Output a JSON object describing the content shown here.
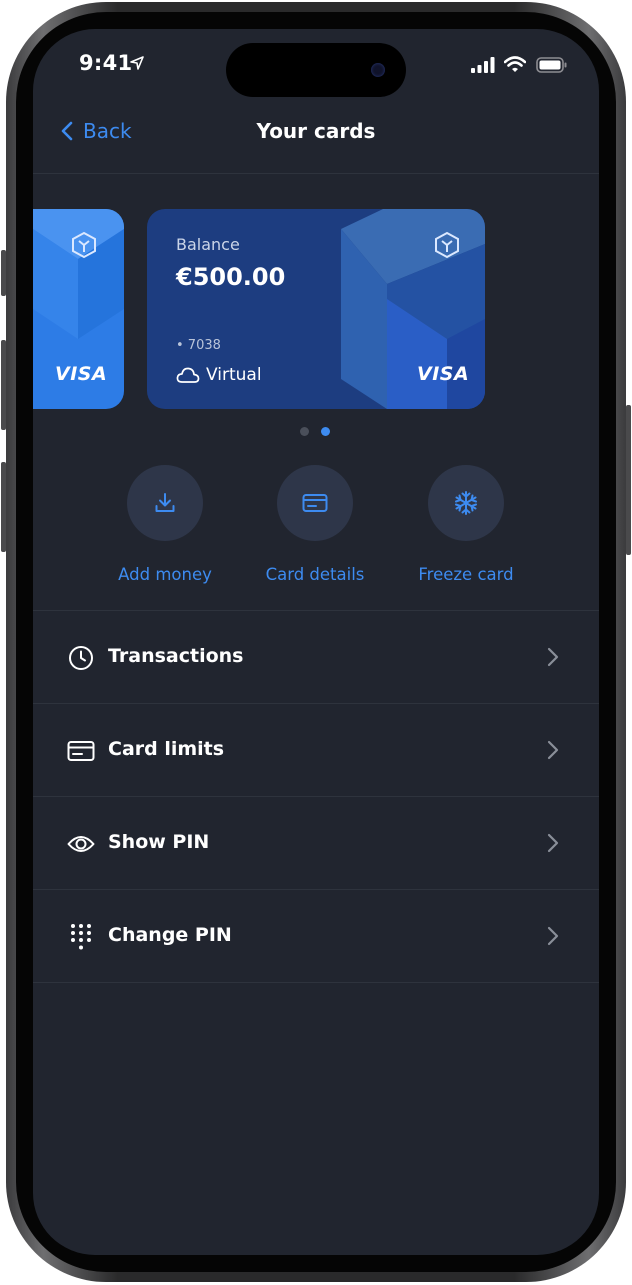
{
  "status_bar": {
    "time": "9:41"
  },
  "nav": {
    "back_label": "Back",
    "title": "Your cards"
  },
  "cards": {
    "partial": {
      "network": "VISA"
    },
    "main": {
      "balance_label": "Balance",
      "balance": "€500.00",
      "number": "• 7038",
      "type": "Virtual",
      "network": "VISA"
    }
  },
  "pager": {
    "total": 2,
    "active_index": 1
  },
  "actions": [
    {
      "label": "Add money",
      "icon": "download-icon"
    },
    {
      "label": "Card details",
      "icon": "card-icon"
    },
    {
      "label": "Freeze card",
      "icon": "snowflake-icon"
    }
  ],
  "menu": [
    {
      "label": "Transactions",
      "icon": "clock-icon"
    },
    {
      "label": "Card limits",
      "icon": "card-limits-icon"
    },
    {
      "label": "Show PIN",
      "icon": "eye-icon"
    },
    {
      "label": "Change PIN",
      "icon": "keypad-icon"
    }
  ],
  "colors": {
    "accent": "#3d8bf0",
    "background": "#21252f",
    "card_main": "#1d3d80",
    "card_left": "#2d7ce6"
  }
}
